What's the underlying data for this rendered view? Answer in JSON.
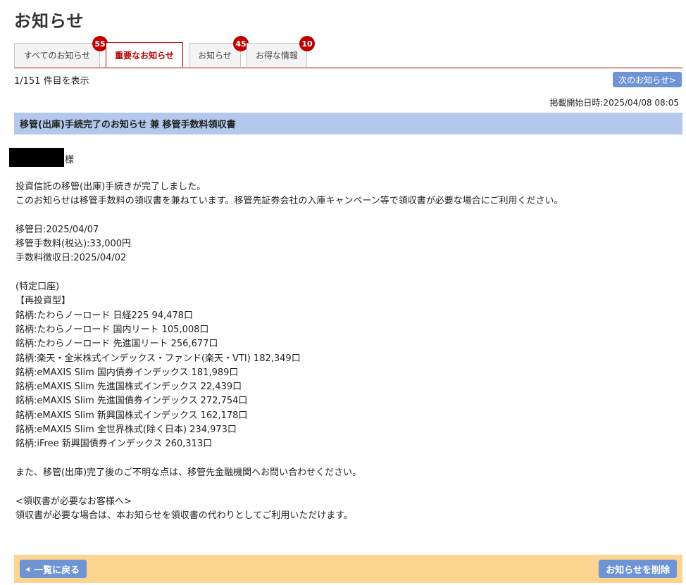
{
  "page": {
    "title": "お知らせ"
  },
  "tabs": [
    {
      "label": "すべてのお知らせ",
      "badge": "55"
    },
    {
      "label": "重要なお知らせ",
      "badge": ""
    },
    {
      "label": "お知らせ",
      "badge": "45"
    },
    {
      "label": "お得な情報",
      "badge": "10"
    }
  ],
  "list": {
    "count_text": "1/151 件目を表示",
    "next_label": "次のお知らせ>"
  },
  "message": {
    "posted_at": "掲載開始日時:2025/04/08 08:05",
    "subject": "移管(出庫)手続完了のお知らせ 兼 移管手数料領収書",
    "recipient_suffix": "様",
    "lines": [
      "投資信託の移管(出庫)手続きが完了しました。",
      "このお知らせは移管手数料の領収書を兼ねています。移管先証券会社の入庫キャンペーン等で領収書が必要な場合にご利用ください。",
      "",
      "移管日:2025/04/07",
      "移管手数料(税込):33,000円",
      "手数料徴収日:2025/04/02",
      "",
      "(特定口座)",
      "【再投資型】",
      "銘柄:たわらノーロード 日経225 94,478口",
      "銘柄:たわらノーロード 国内リート 105,008口",
      "銘柄:たわらノーロード 先進国リート 256,677口",
      "銘柄:楽天・全米株式インデックス・ファンド(楽天・VTI) 182,349口",
      "銘柄:eMAXIS Slim 国内債券インデックス 181,989口",
      "銘柄:eMAXIS Slim 先進国株式インデックス 22,439口",
      "銘柄:eMAXIS Slim 先進国債券インデックス 272,754口",
      "銘柄:eMAXIS Slim 新興国株式インデックス 162,178口",
      "銘柄:eMAXIS Slim 全世界株式(除く日本) 234,973口",
      "銘柄:iFree 新興国債券インデックス 260,313口",
      "",
      "また、移管(出庫)完了後のご不明な点は、移管先金融機関へお問い合わせください。",
      "",
      "<領収書が必要なお客様へ>",
      "領収書が必要な場合は、本お知らせを領収書の代わりとしてご利用いただけます。"
    ]
  },
  "footer": {
    "back_label": "一覧に戻る",
    "delete_label": "お知らせを削除"
  },
  "colors": {
    "accent_red": "#b50000",
    "badge_red": "#c00000",
    "button_blue": "#6f94d6",
    "subject_bg": "#b4c8ee",
    "footer_bg": "#fcd591"
  }
}
